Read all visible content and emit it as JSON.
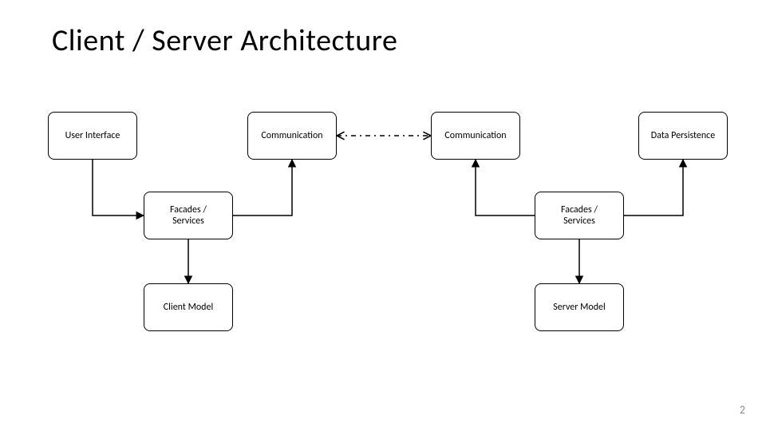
{
  "title": "Client / Server Architecture",
  "page_number": "2",
  "boxes": {
    "ui": {
      "label": "User Interface"
    },
    "fs_client": {
      "label": "Facades /\nServices"
    },
    "comm_client": {
      "label": "Communication"
    },
    "client_model": {
      "label": "Client Model"
    },
    "comm_server": {
      "label": "Communication"
    },
    "fs_server": {
      "label": "Facades /\nServices"
    },
    "persist": {
      "label": "Data Persistence"
    },
    "server_model": {
      "label": "Server Model"
    }
  },
  "connectors": [
    {
      "from": "ui",
      "to": "fs_client",
      "style": "elbow-down-right"
    },
    {
      "from": "fs_client",
      "to": "comm_client",
      "style": "elbow-right-up"
    },
    {
      "from": "fs_client",
      "to": "client_model",
      "style": "straight-down"
    },
    {
      "from": "comm_client",
      "to": "comm_server",
      "style": "dashed-bidirectional"
    },
    {
      "from": "comm_server",
      "to": "fs_server",
      "style": "elbow-down-right-rev"
    },
    {
      "from": "fs_server",
      "to": "persist",
      "style": "elbow-right-up"
    },
    {
      "from": "fs_server",
      "to": "server_model",
      "style": "straight-down"
    }
  ]
}
